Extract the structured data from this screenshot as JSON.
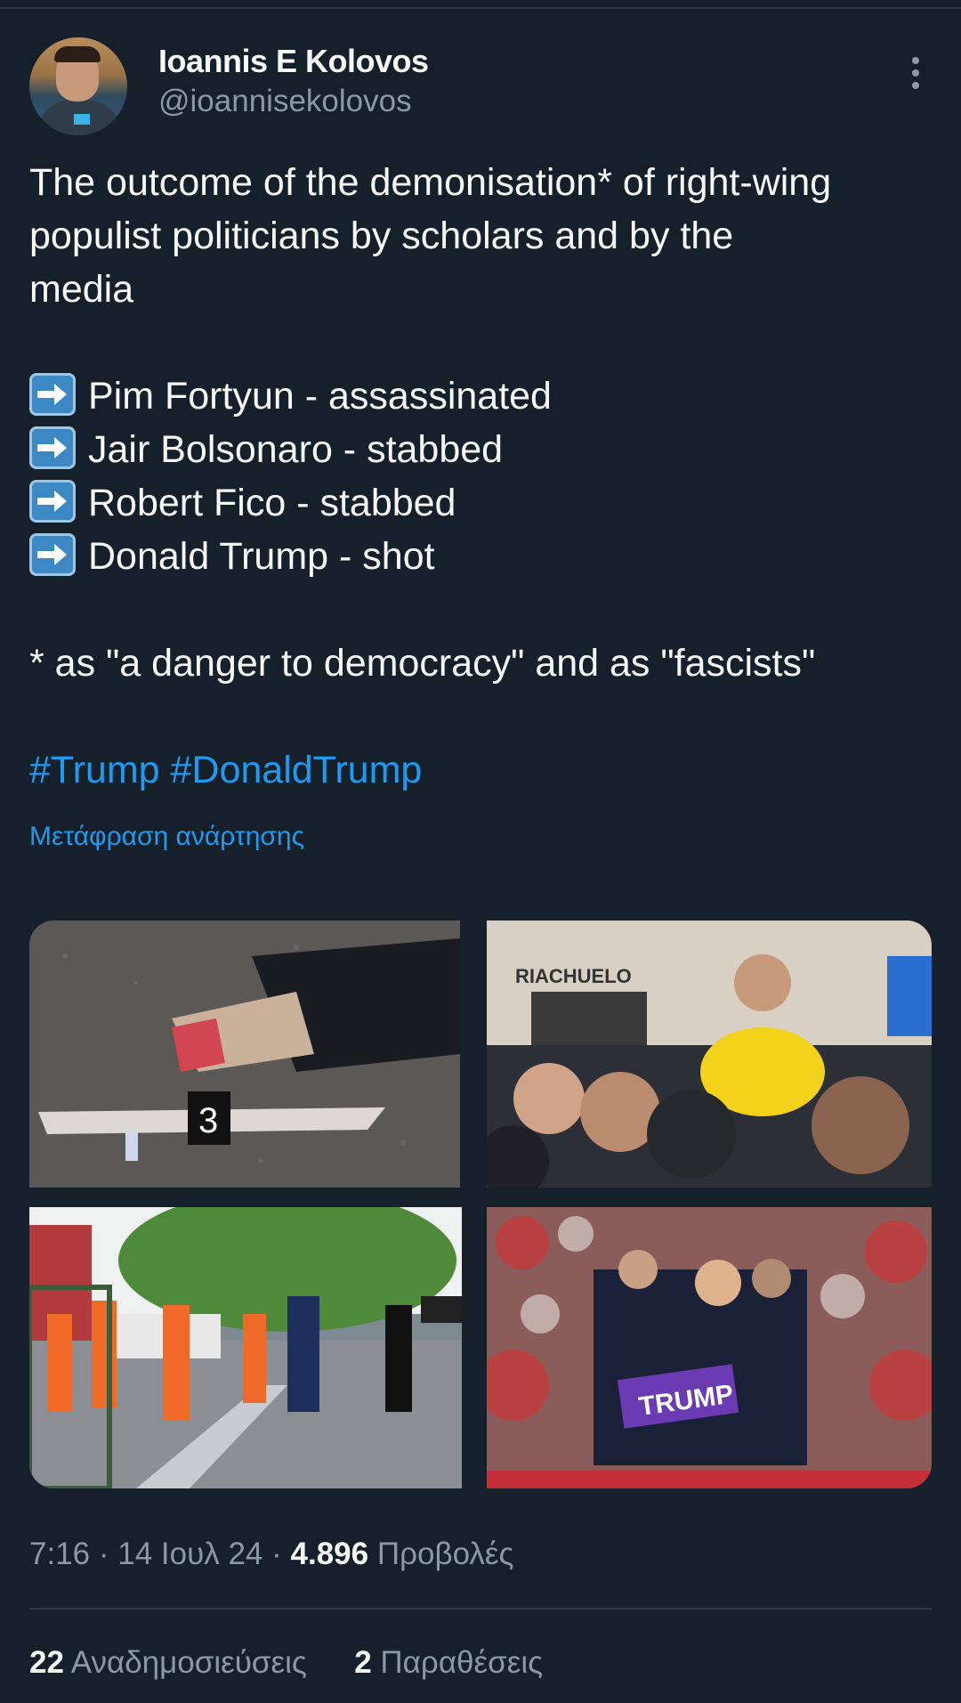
{
  "author": {
    "name": "Ioannis E Kolovos",
    "handle": "@ioannisekolovos"
  },
  "post": {
    "line1": "The outcome of the demonisation* of right-wing",
    "line2": "populist politicians by scholars and by the",
    "line3": "media",
    "items": [
      "Pim Fortyun - assassinated",
      "Jair Bolsonaro - stabbed",
      "Robert Fico - stabbed",
      "Donald Trump - shot"
    ],
    "footnote": "* as \"a danger to democracy\" and as \"fascists\"",
    "hashtags": "#Trump #DonaldTrump",
    "translate_label": "Μετάφραση ανάρτησης"
  },
  "images": {
    "img1_marker": "3",
    "img2_sign": "RIACHUELO",
    "img4_sign": "TRUMP"
  },
  "meta": {
    "time": "7:16",
    "date": "14 Ιουλ 24",
    "views_count": "4.896",
    "views_label": "Προβολές"
  },
  "stats": {
    "reposts_count": "22",
    "reposts_label": "Αναδημοσιεύσεις",
    "quotes_count": "2",
    "quotes_label": "Παραθέσεις"
  },
  "colors": {
    "background": "#15202b",
    "accent": "#1d9bf0",
    "secondary_text": "#8b98a5"
  },
  "icons": [
    "more-options-icon",
    "right-arrow-emoji-icon"
  ]
}
